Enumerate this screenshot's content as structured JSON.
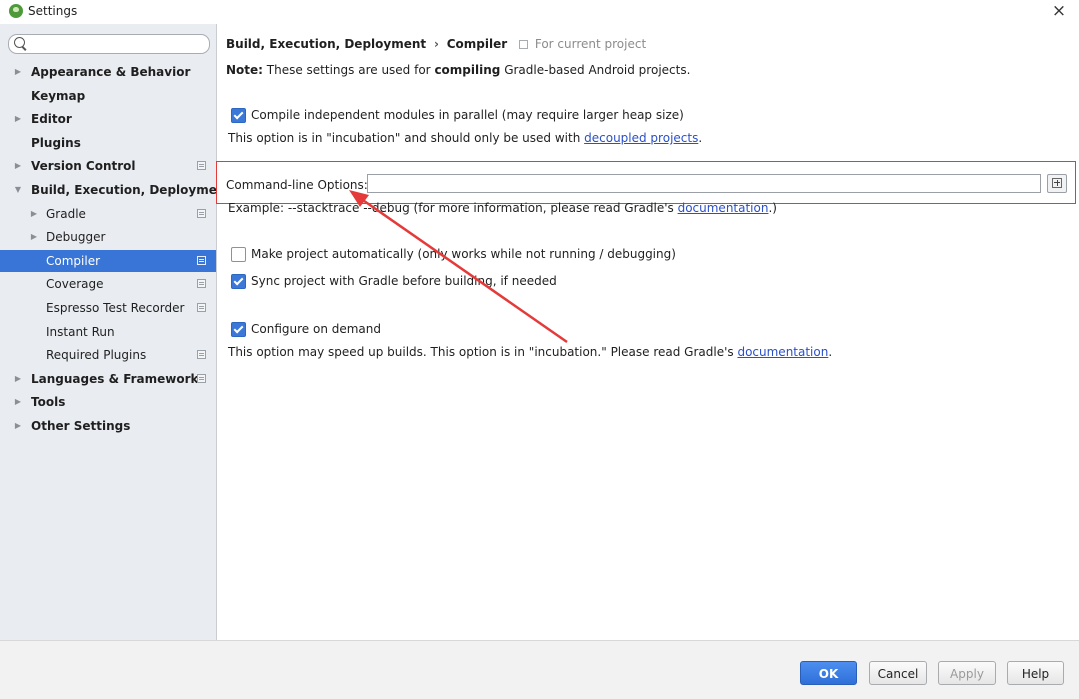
{
  "window": {
    "title": "Settings",
    "close_glyph": "×"
  },
  "search": {
    "placeholder": "",
    "value": ""
  },
  "sidebar": {
    "items": [
      {
        "label": "Appearance & Behavior",
        "level": 0,
        "expandable": true,
        "expanded": false,
        "bold": true,
        "project_icon": false
      },
      {
        "label": "Keymap",
        "level": 0,
        "expandable": false,
        "bold": true,
        "project_icon": false
      },
      {
        "label": "Editor",
        "level": 0,
        "expandable": true,
        "expanded": false,
        "bold": true,
        "project_icon": false
      },
      {
        "label": "Plugins",
        "level": 0,
        "expandable": false,
        "bold": true,
        "project_icon": false
      },
      {
        "label": "Version Control",
        "level": 0,
        "expandable": true,
        "expanded": false,
        "bold": true,
        "project_icon": true
      },
      {
        "label": "Build, Execution, Deployment",
        "level": 0,
        "expandable": true,
        "expanded": true,
        "bold": true,
        "project_icon": false
      },
      {
        "label": "Gradle",
        "level": 1,
        "expandable": true,
        "expanded": false,
        "bold": false,
        "project_icon": true
      },
      {
        "label": "Debugger",
        "level": 1,
        "expandable": true,
        "expanded": false,
        "bold": false,
        "project_icon": false
      },
      {
        "label": "Compiler",
        "level": 1,
        "expandable": false,
        "bold": false,
        "project_icon": true,
        "selected": true
      },
      {
        "label": "Coverage",
        "level": 1,
        "expandable": false,
        "bold": false,
        "project_icon": true
      },
      {
        "label": "Espresso Test Recorder",
        "level": 1,
        "expandable": false,
        "bold": false,
        "project_icon": true
      },
      {
        "label": "Instant Run",
        "level": 1,
        "expandable": false,
        "bold": false,
        "project_icon": false
      },
      {
        "label": "Required Plugins",
        "level": 1,
        "expandable": false,
        "bold": false,
        "project_icon": true
      },
      {
        "label": "Languages & Frameworks",
        "level": 0,
        "expandable": true,
        "expanded": false,
        "bold": true,
        "project_icon": true
      },
      {
        "label": "Tools",
        "level": 0,
        "expandable": true,
        "expanded": false,
        "bold": true,
        "project_icon": false
      },
      {
        "label": "Other Settings",
        "level": 0,
        "expandable": true,
        "expanded": false,
        "bold": true,
        "project_icon": false
      }
    ]
  },
  "breadcrumb": {
    "parent": "Build, Execution, Deployment",
    "separator": "›",
    "current": "Compiler",
    "scope": "For current project"
  },
  "note": {
    "prefix": "Note:",
    "text1": " These settings are used for ",
    "emphasis": "compiling",
    "text2": " Gradle-based Android projects."
  },
  "options": {
    "parallel": {
      "label": "Compile independent modules in parallel (may require larger heap size)",
      "checked": true
    },
    "parallel_desc": {
      "text": "This option is in \"incubation\" and should only be used with ",
      "link": "decoupled projects",
      "suffix": "."
    },
    "cmdline": {
      "label": "Command-line Options:",
      "value": "",
      "expand_icon": "expand-icon"
    },
    "cmdline_example": {
      "text": "Example: --stacktrace --debug (for more information, please read Gradle's ",
      "link": "documentation",
      "suffix": ".)"
    },
    "make_auto": {
      "label": "Make project automatically (only works while not running / debugging)",
      "checked": false
    },
    "sync": {
      "label": "Sync project with Gradle before building, if needed",
      "checked": true
    },
    "on_demand": {
      "label": "Configure on demand",
      "checked": true
    },
    "on_demand_desc": {
      "text": "This option may speed up builds. This option is in \"incubation.\" Please read Gradle's ",
      "link": "documentation",
      "suffix": "."
    }
  },
  "annotation": {
    "color": "#e53a3a"
  },
  "footer": {
    "ok": "OK",
    "cancel": "Cancel",
    "apply": "Apply",
    "help": "Help"
  },
  "colors": {
    "selection": "#3875d7",
    "link": "#2a4fc8",
    "sidebar_bg": "#e9edf2"
  }
}
